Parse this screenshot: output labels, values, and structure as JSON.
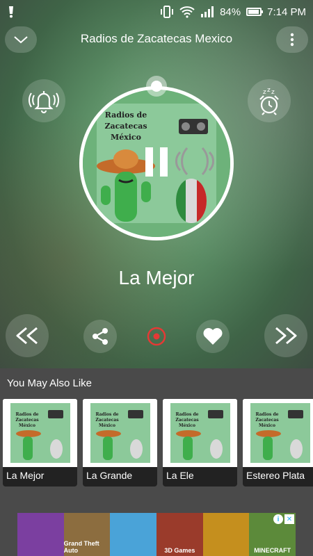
{
  "status": {
    "battery": "84%",
    "time": "7:14 PM",
    "icons": [
      "notification-icon",
      "vibrate-icon",
      "wifi-icon",
      "signal-icon",
      "battery-icon"
    ]
  },
  "header": {
    "title": "Radios de Zacatecas Mexico"
  },
  "player": {
    "station_name": "La Mejor",
    "art_title_lines": [
      "Radios de",
      "Zacatecas",
      "México"
    ],
    "state": "playing",
    "accent": "#e53935"
  },
  "suggestions": {
    "title": "You May Also Like",
    "items": [
      {
        "label": "La Mejor"
      },
      {
        "label": "La Grande"
      },
      {
        "label": "La Ele"
      },
      {
        "label": "Estereo Plata"
      }
    ]
  },
  "ad": {
    "tiles": [
      {
        "label": "",
        "color": "#7b3fa0"
      },
      {
        "label": "Grand Theft Auto",
        "color": "#8c6d3f"
      },
      {
        "label": "",
        "color": "#4aa3d8"
      },
      {
        "label": "3D Games",
        "color": "#9a3b2b"
      },
      {
        "label": "",
        "color": "#c58f1e"
      },
      {
        "label": "MINECRAFT",
        "color": "#5c8a3a"
      }
    ]
  }
}
